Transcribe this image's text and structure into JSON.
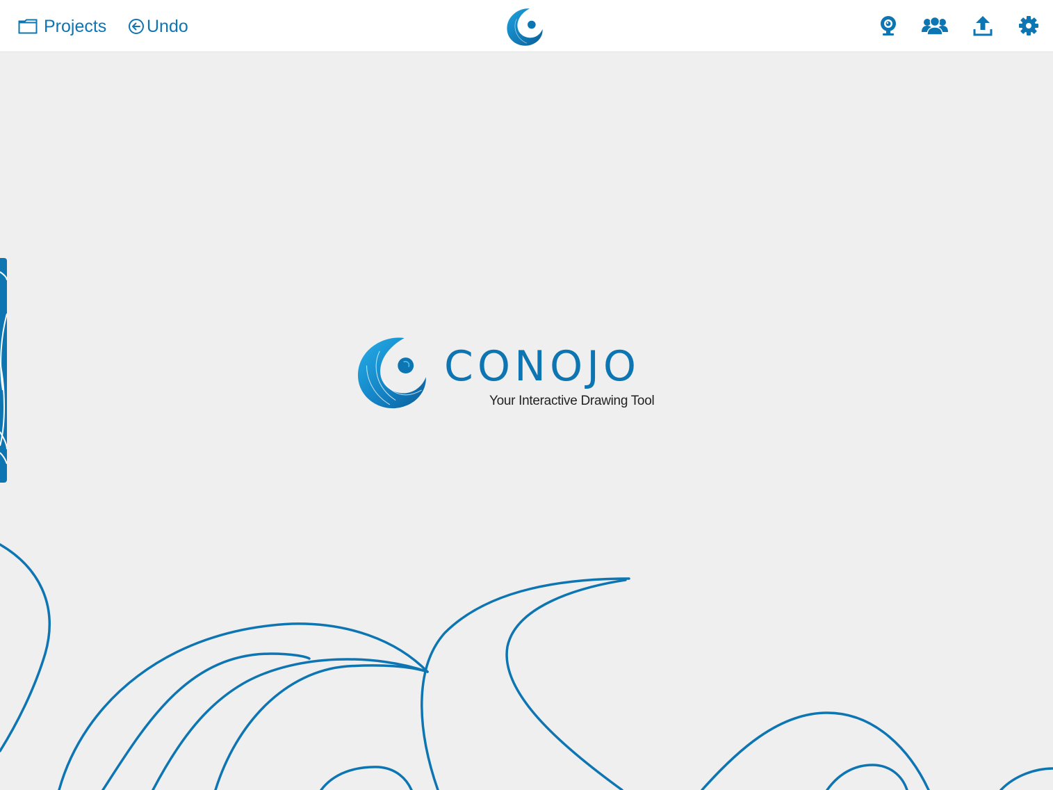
{
  "topbar": {
    "projects_label": "Projects",
    "undo_label": "Undo",
    "accent_color": "#0e75b3"
  },
  "icons": {
    "projects": "folder-icon",
    "undo": "arrow-left-circle-icon",
    "logo": "conojo-crescent-logo",
    "webcam": "webcam-icon",
    "collaborate": "users-group-icon",
    "upload": "upload-icon",
    "settings": "gear-icon"
  },
  "splash": {
    "brand_name": "CONOJO",
    "tagline": "Your Interactive Drawing Tool"
  }
}
